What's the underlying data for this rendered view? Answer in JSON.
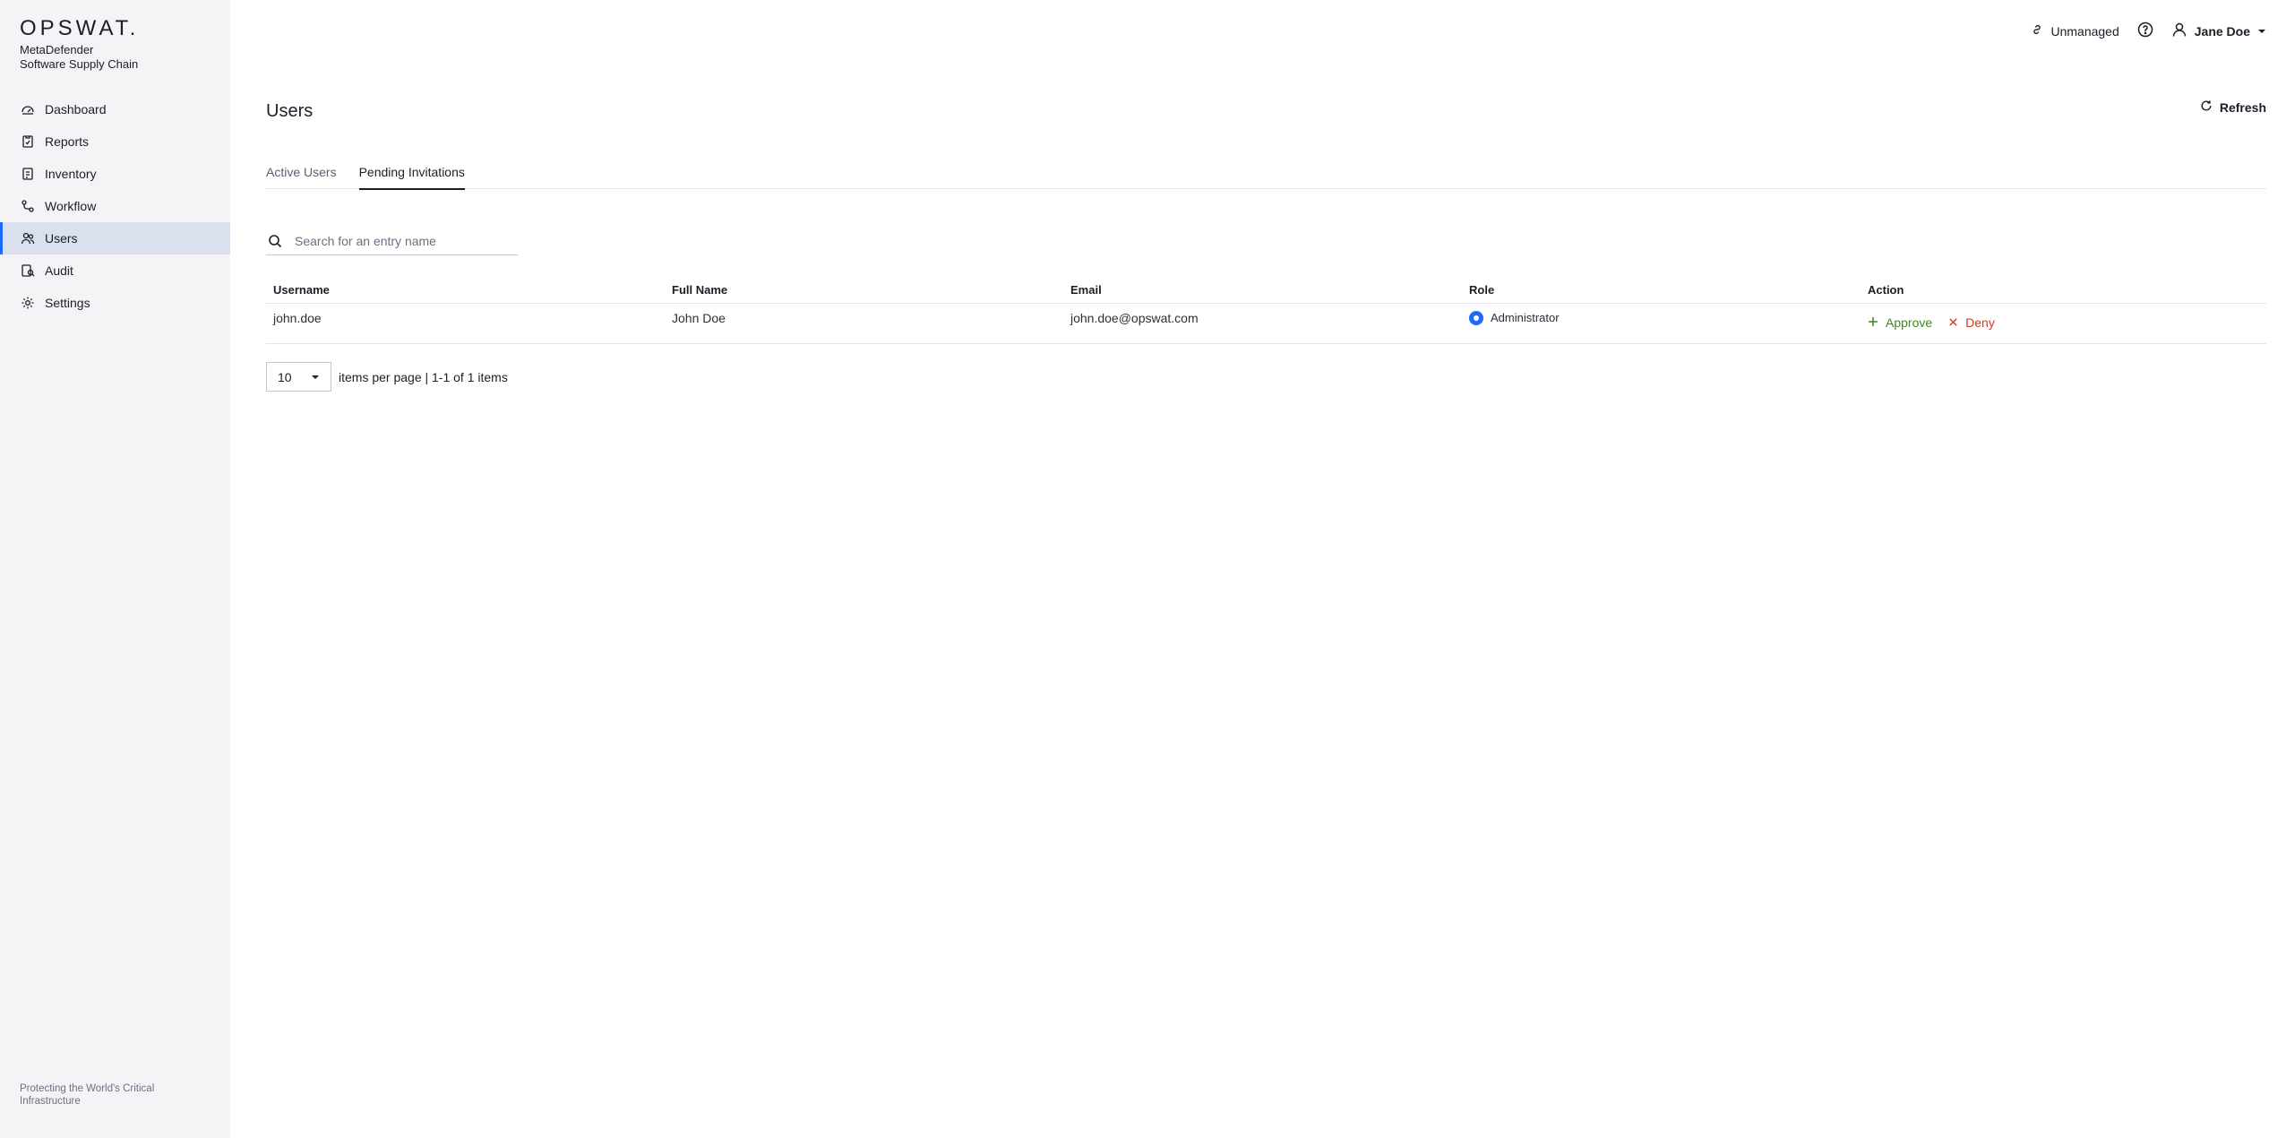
{
  "brand": {
    "logo": "OPSWAT.",
    "product_line1": "MetaDefender",
    "product_line2": "Software Supply Chain",
    "tagline": "Protecting the World's Critical Infrastructure"
  },
  "sidebar": {
    "items": [
      {
        "label": "Dashboard",
        "icon": "dashboard-icon"
      },
      {
        "label": "Reports",
        "icon": "reports-icon"
      },
      {
        "label": "Inventory",
        "icon": "inventory-icon"
      },
      {
        "label": "Workflow",
        "icon": "workflow-icon"
      },
      {
        "label": "Users",
        "icon": "users-icon",
        "active": true
      },
      {
        "label": "Audit",
        "icon": "audit-icon"
      },
      {
        "label": "Settings",
        "icon": "gear-icon"
      }
    ]
  },
  "topbar": {
    "status": "Unmanaged",
    "user": "Jane Doe"
  },
  "page": {
    "title": "Users",
    "refresh": "Refresh",
    "tabs": [
      "Active Users",
      "Pending Invitations"
    ],
    "active_tab": "Pending Invitations"
  },
  "search": {
    "placeholder": "Search for an entry name",
    "value": ""
  },
  "table": {
    "columns": [
      "Username",
      "Full Name",
      "Email",
      "Role",
      "Action"
    ],
    "rows": [
      {
        "username": "john.doe",
        "full_name": "John Doe",
        "email": "john.doe@opswat.com",
        "role": "Administrator",
        "approve": "Approve",
        "deny": "Deny"
      }
    ]
  },
  "pager": {
    "page_size": "10",
    "summary": "items per page | 1-1 of 1 items"
  },
  "colors": {
    "accent": "#1d6bfc",
    "approve": "#3f8a1f",
    "deny": "#d23a2a",
    "sidebar_bg": "#f4f4f7",
    "active_bg": "#dbe0ef"
  }
}
